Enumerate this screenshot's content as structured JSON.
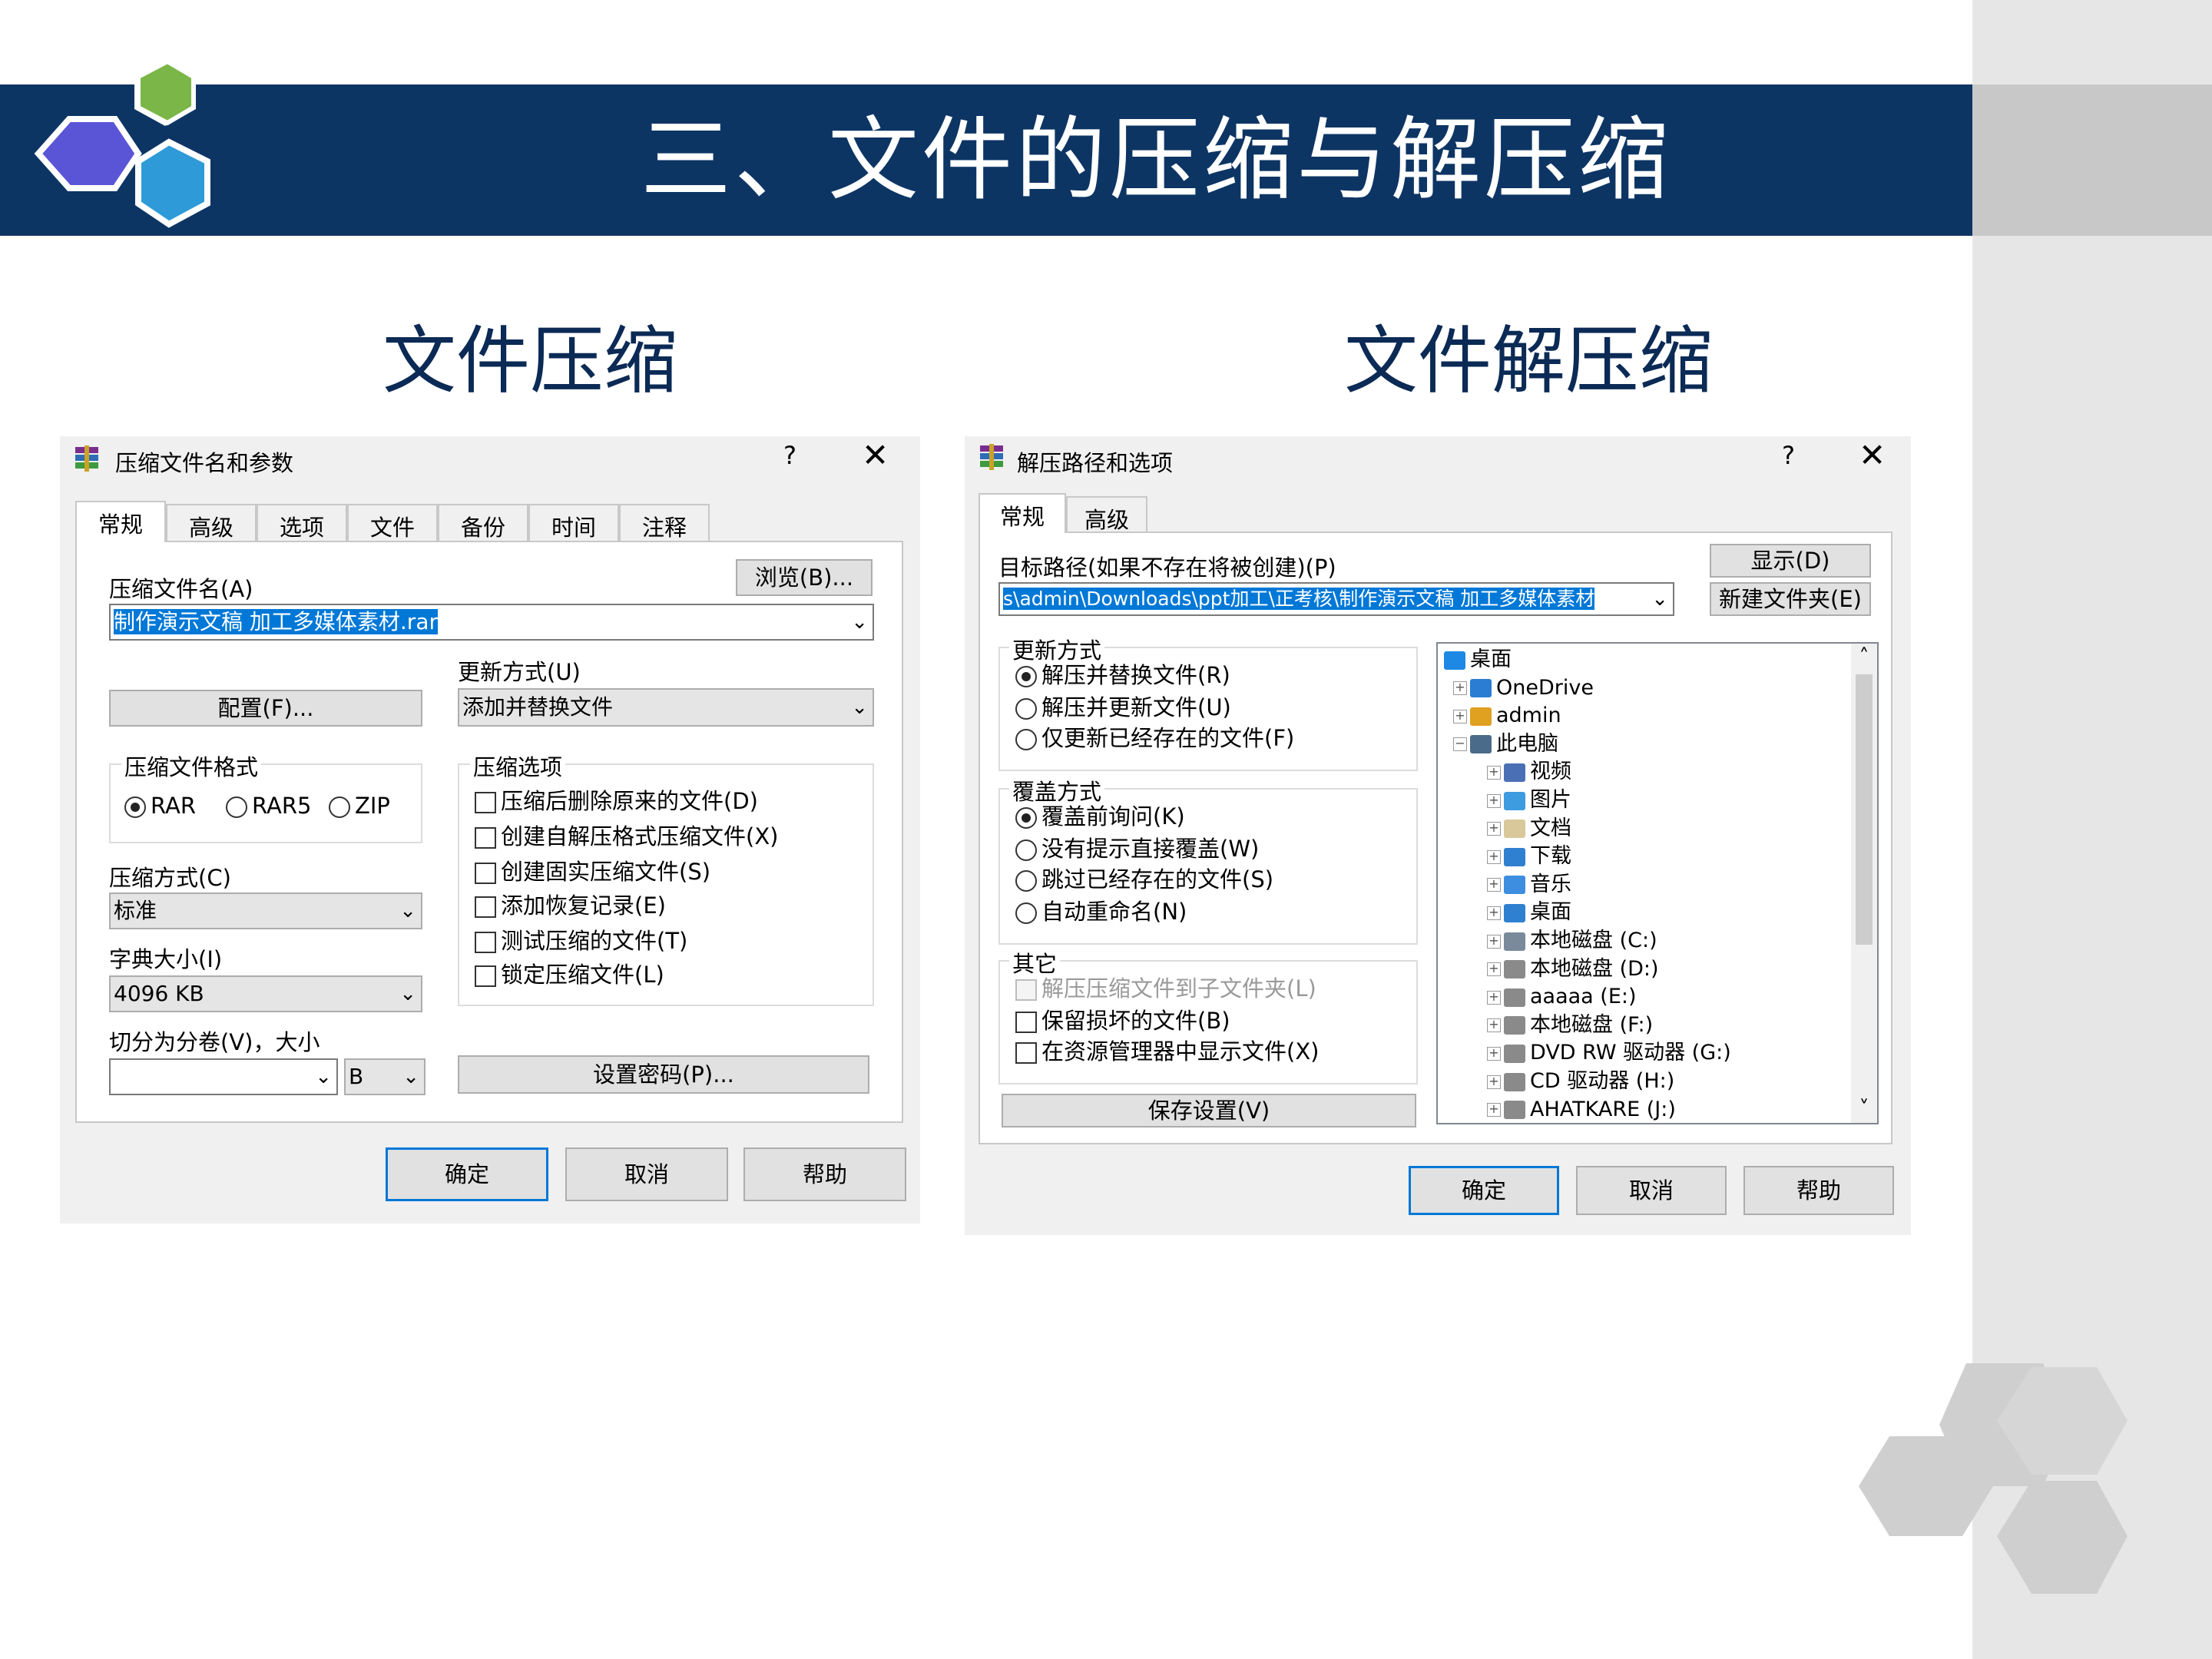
{
  "slide": {
    "title": "三、文件的压缩与解压缩",
    "left_subtitle": "文件压缩",
    "right_subtitle": "文件解压缩"
  },
  "compress_dialog": {
    "window_title": "压缩文件名和参数",
    "help_glyph": "?",
    "close_glyph": "✕",
    "tabs": [
      "常规",
      "高级",
      "选项",
      "文件",
      "备份",
      "时间",
      "注释"
    ],
    "archive_name_label": "压缩文件名(A)",
    "browse_button": "浏览(B)...",
    "archive_name_value": "制作演示文稿 加工多媒体素材.rar",
    "update_mode_label": "更新方式(U)",
    "profiles_button": "配置(F)...",
    "update_mode_value": "添加并替换文件",
    "format_group": "压缩文件格式",
    "formats": [
      {
        "label": "RAR",
        "checked": true
      },
      {
        "label": "RAR5",
        "checked": false
      },
      {
        "label": "ZIP",
        "checked": false
      }
    ],
    "options_group": "压缩选项",
    "options": [
      "压缩后删除原来的文件(D)",
      "创建自解压格式压缩文件(X)",
      "创建固实压缩文件(S)",
      "添加恢复记录(E)",
      "测试压缩的文件(T)",
      "锁定压缩文件(L)"
    ],
    "method_label": "压缩方式(C)",
    "method_value": "标准",
    "dict_label": "字典大小(I)",
    "dict_value": "4096 KB",
    "split_label": "切分为分卷(V)，大小",
    "split_value": "",
    "split_unit": "B",
    "password_button": "设置密码(P)...",
    "ok_button": "确定",
    "cancel_button": "取消",
    "help_button": "帮助",
    "dropdown_glyph": "⌄"
  },
  "extract_dialog": {
    "window_title": "解压路径和选项",
    "help_glyph": "?",
    "close_glyph": "✕",
    "tabs": [
      "常规",
      "高级"
    ],
    "dest_label": "目标路径(如果不存在将被创建)(P)",
    "dest_value": "s\\admin\\Downloads\\ppt加工\\正考核\\制作演示文稿 加工多媒体素材",
    "show_button": "显示(D)",
    "new_folder_button": "新建文件夹(E)",
    "update_group": "更新方式",
    "update_options": [
      {
        "label": "解压并替换文件(R)",
        "checked": true
      },
      {
        "label": "解压并更新文件(U)",
        "checked": false
      },
      {
        "label": "仅更新已经存在的文件(F)",
        "checked": false
      }
    ],
    "overwrite_group": "覆盖方式",
    "overwrite_options": [
      {
        "label": "覆盖前询问(K)",
        "checked": true
      },
      {
        "label": "没有提示直接覆盖(W)",
        "checked": false
      },
      {
        "label": "跳过已经存在的文件(S)",
        "checked": false
      },
      {
        "label": "自动重命名(N)",
        "checked": false
      }
    ],
    "misc_group": "其它",
    "misc_options": [
      {
        "label": "解压压缩文件到子文件夹(L)",
        "disabled": true
      },
      {
        "label": "保留损坏的文件(B)",
        "disabled": false
      },
      {
        "label": "在资源管理器中显示文件(X)",
        "disabled": false
      }
    ],
    "save_button": "保存设置(V)",
    "tree": {
      "root": "桌面",
      "items": [
        {
          "label": "OneDrive",
          "icon": "cloud-icon",
          "color": "#2b7cd3"
        },
        {
          "label": "admin",
          "icon": "user-icon",
          "color": "#e0a020"
        },
        {
          "label": "此电脑",
          "icon": "computer-icon",
          "color": "#4a6b8a"
        },
        {
          "label": "视频",
          "icon": "video-folder-icon",
          "color": "#4a6fb5"
        },
        {
          "label": "图片",
          "icon": "pictures-folder-icon",
          "color": "#3d9be0"
        },
        {
          "label": "文档",
          "icon": "documents-folder-icon",
          "color": "#d8c89a"
        },
        {
          "label": "下载",
          "icon": "downloads-folder-icon",
          "color": "#2f80d0"
        },
        {
          "label": "音乐",
          "icon": "music-folder-icon",
          "color": "#3d8de0"
        },
        {
          "label": "桌面",
          "icon": "desktop-folder-icon",
          "color": "#2f80d0"
        },
        {
          "label": "本地磁盘 (C:)",
          "icon": "system-drive-icon",
          "color": "#7a8a9a"
        },
        {
          "label": "本地磁盘 (D:)",
          "icon": "drive-icon",
          "color": "#8a8a8a"
        },
        {
          "label": "aaaaa (E:)",
          "icon": "drive-icon",
          "color": "#8a8a8a"
        },
        {
          "label": "本地磁盘 (F:)",
          "icon": "drive-icon",
          "color": "#8a8a8a"
        },
        {
          "label": "DVD RW 驱动器 (G:)",
          "icon": "dvd-drive-icon",
          "color": "#8a8a8a"
        },
        {
          "label": "CD 驱动器 (H:)",
          "icon": "cd-drive-icon",
          "color": "#8a8a8a"
        },
        {
          "label": "AHATKARE (J:)",
          "icon": "drive-icon",
          "color": "#8a8a8a"
        }
      ]
    },
    "ok_button": "确定",
    "cancel_button": "取消",
    "help_button": "帮助",
    "dropdown_glyph": "⌄",
    "scroll_up_glyph": "˄",
    "scroll_down_glyph": "˅"
  },
  "colors": {
    "banner": "#0d3564",
    "hex_green": "#7ab648",
    "hex_blue": "#2e9ad8",
    "hex_purple": "#5a55d6",
    "hex_gray": "#cfcfcf",
    "selection": "#0078d7"
  }
}
